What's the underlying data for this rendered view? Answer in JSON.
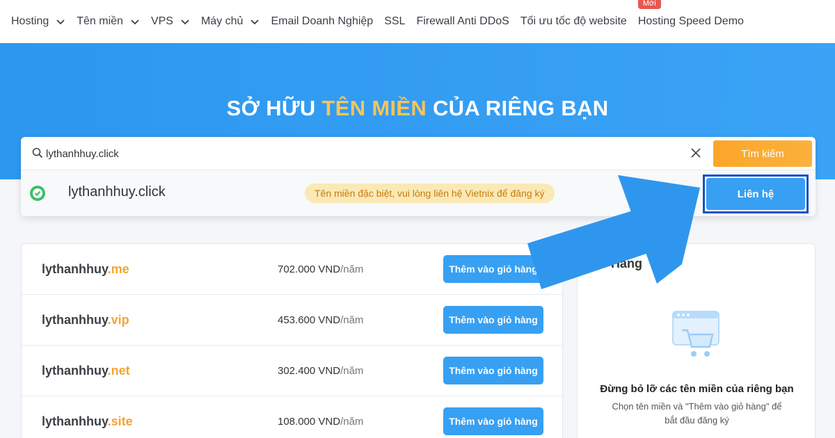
{
  "nav": {
    "items": [
      {
        "label": "Hosting",
        "dropdown": true
      },
      {
        "label": "Tên miền",
        "dropdown": true
      },
      {
        "label": "VPS",
        "dropdown": true
      },
      {
        "label": "Máy chủ",
        "dropdown": true
      },
      {
        "label": "Email Doanh Nghiệp",
        "dropdown": false
      },
      {
        "label": "SSL",
        "dropdown": false
      },
      {
        "label": "Firewall Anti DDoS",
        "dropdown": false
      },
      {
        "label": "Tối ưu tốc độ website",
        "dropdown": false
      },
      {
        "label": "Hosting Speed Demo",
        "dropdown": false,
        "badge": "Mới"
      }
    ]
  },
  "hero": {
    "title_before": "SỞ HỮU ",
    "title_highlight": "TÊN MIỀN",
    "title_after": " CỦA RIÊNG BẠN"
  },
  "search": {
    "value": "lythanhhuy.click",
    "button_label": "Tìm kiếm",
    "icon": "search-icon",
    "clear_icon": "close-icon"
  },
  "result": {
    "domain": "lythanhhuy.click",
    "note": "Tên miền đặc biệt, vui lòng liên hệ Vietnix để đăng ký",
    "button_label": "Liên hệ",
    "status_icon": "check-circle-icon"
  },
  "domains": [
    {
      "name": "lythanhhuy",
      "tld": ".me",
      "price": "702.000 VND",
      "unit": "/năm",
      "button_label": "Thêm vào giỏ hàng"
    },
    {
      "name": "lythanhhuy",
      "tld": ".vip",
      "price": "453.600 VND",
      "unit": "/năm",
      "button_label": "Thêm vào giỏ hàng"
    },
    {
      "name": "lythanhhuy",
      "tld": ".net",
      "price": "302.400 VND",
      "unit": "/năm",
      "button_label": "Thêm vào giỏ hàng"
    },
    {
      "name": "lythanhhuy",
      "tld": ".site",
      "price": "108.000 VND",
      "unit": "/năm",
      "button_label": "Thêm vào giỏ hàng"
    }
  ],
  "cart": {
    "title": "Hàng",
    "heading": "Đừng bỏ lỡ các tên miền của riêng bạn",
    "subtext": "Chọn tên miền và \"Thêm vào giỏ hàng\" để bắt đầu đăng ký",
    "icon": "cart-icon"
  },
  "colors": {
    "hero_blue": "#3aa3f6",
    "accent_orange": "#fbb13c",
    "button_blue": "#37a0f3",
    "highlight_frame": "#1550c9",
    "tld_orange": "#f4a435"
  }
}
